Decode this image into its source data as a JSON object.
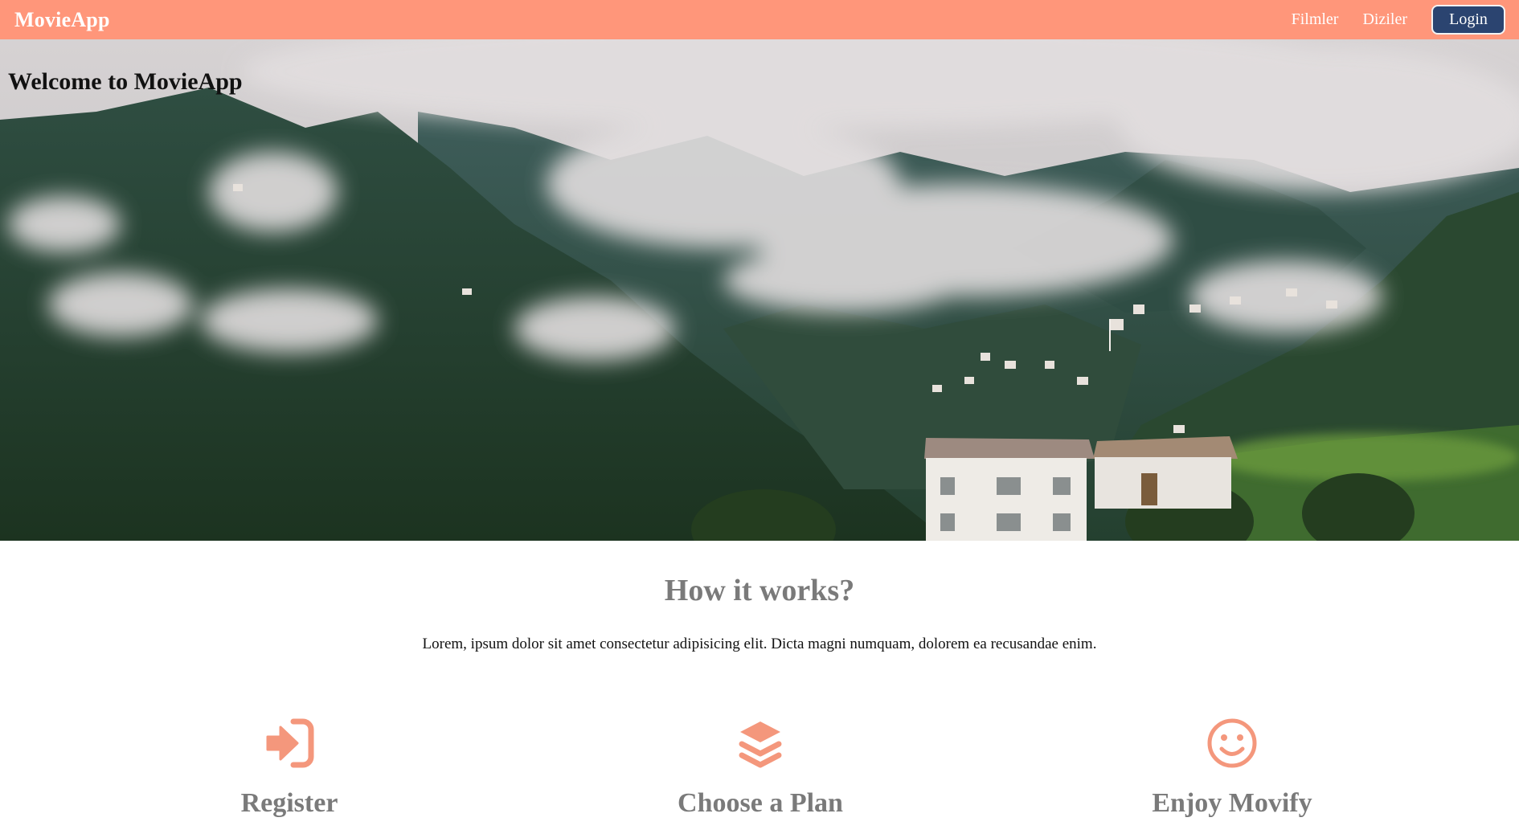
{
  "navbar": {
    "brand": "MovieApp",
    "links": [
      "Filmler",
      "Diziler"
    ],
    "login_label": "Login",
    "bg_color": "#ff967a",
    "login_color": "#2b4470"
  },
  "hero": {
    "title": "Welcome to MovieApp",
    "image": "misty-mountain-village"
  },
  "how_it_works": {
    "title": "How it works?",
    "text": "Lorem, ipsum dolor sit amet consectetur adipisicing elit. Dicta magni numquam, dolorem ea recusandae enim.",
    "accent_color": "#f4977c",
    "steps": [
      {
        "icon": "sign-in-icon",
        "label": "Register"
      },
      {
        "icon": "layers-icon",
        "label": "Choose a Plan"
      },
      {
        "icon": "smile-icon",
        "label": "Enjoy Movify"
      }
    ]
  }
}
